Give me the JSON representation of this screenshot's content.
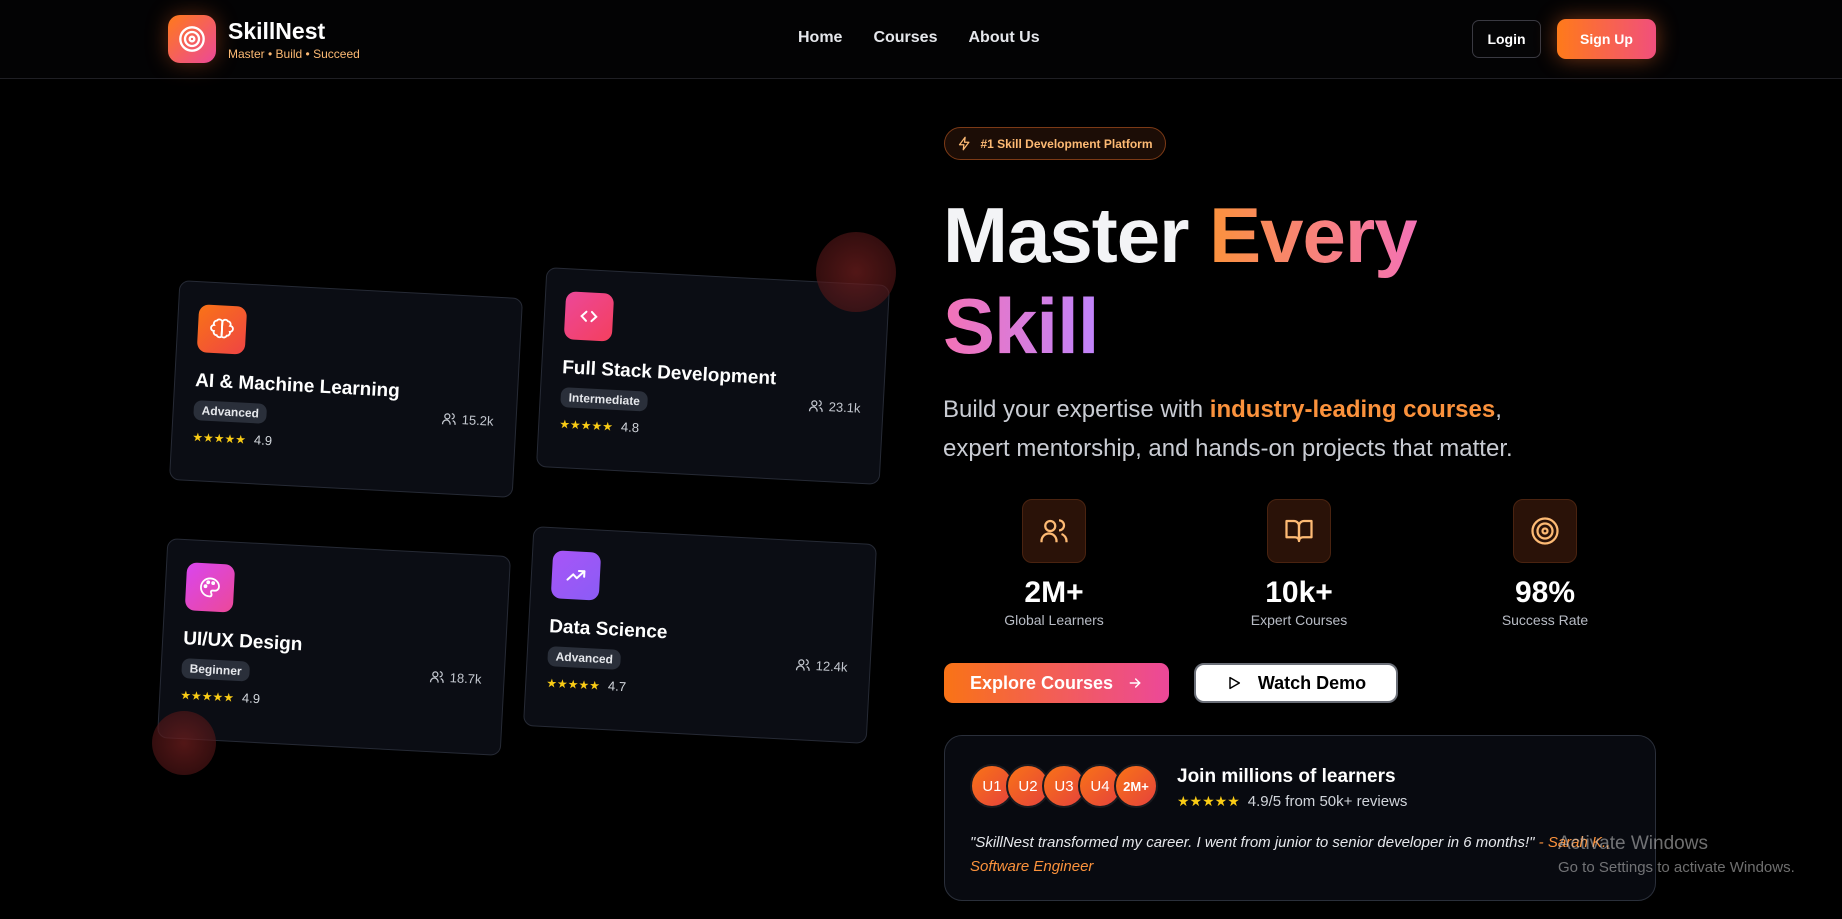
{
  "brand": {
    "name": "SkillNest",
    "tagline": "Master • Build • Succeed",
    "logo_icon": "target-icon",
    "accent": "#f97316",
    "accent2": "#ec4899"
  },
  "nav": {
    "links": [
      "Home",
      "Courses",
      "About Us"
    ],
    "login_label": "Login",
    "signup_label": "Sign Up"
  },
  "cards": [
    {
      "title": "AI & Machine Learning",
      "level": "Advanced",
      "stars": "★★★★★",
      "rating": "4.9",
      "students": "15.2k",
      "icon": "brain-icon"
    },
    {
      "title": "Full Stack Development",
      "level": "Intermediate",
      "stars": "★★★★★",
      "rating": "4.8",
      "students": "23.1k",
      "icon": "code-icon"
    },
    {
      "title": "UI/UX Design",
      "level": "Beginner",
      "stars": "★★★★★",
      "rating": "4.9",
      "students": "18.7k",
      "icon": "palette-icon"
    },
    {
      "title": "Data Science",
      "level": "Advanced",
      "stars": "★★★★★",
      "rating": "4.7",
      "students": "12.4k",
      "icon": "trending-up-icon"
    }
  ],
  "hero": {
    "badge": "#1 Skill Development Platform",
    "title_word1": "Master",
    "title_word2": "Every",
    "title_word3": "Skill",
    "subtitle_pre": "Build your expertise with ",
    "subtitle_highlight": "industry-leading courses",
    "subtitle_post": ", expert mentorship, and hands-on projects that matter."
  },
  "stats": [
    {
      "value": "2M+",
      "label": "Global Learners",
      "icon": "users-icon"
    },
    {
      "value": "10k+",
      "label": "Expert Courses",
      "icon": "book-open-icon"
    },
    {
      "value": "98%",
      "label": "Success Rate",
      "icon": "target-icon"
    }
  ],
  "buttons": {
    "explore": "Explore Courses",
    "demo": "Watch Demo"
  },
  "join": {
    "avatars": [
      "U1",
      "U2",
      "U3",
      "U4",
      "2M+"
    ],
    "title": "Join millions of learners",
    "stars": "★★★★★",
    "rating_text": "4.9/5 from 50k+ reviews",
    "quote": "\"SkillNest transformed my career. I went from junior to senior developer in 6 months!\"",
    "author": " - Sarah K., Software Engineer"
  },
  "watermark": {
    "title": "Activate Windows",
    "subtitle": "Go to Settings to activate Windows."
  }
}
